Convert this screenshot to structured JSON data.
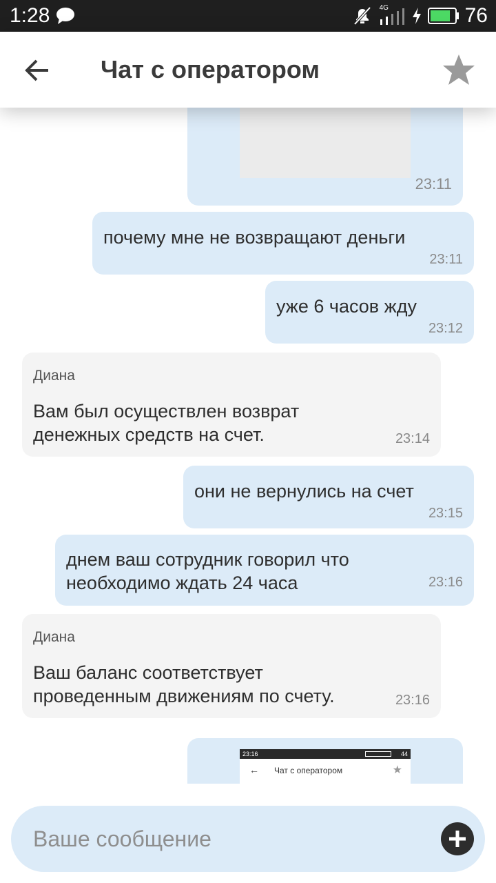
{
  "status_bar": {
    "time": "1:28",
    "network": "4G",
    "battery": "76"
  },
  "header": {
    "title": "Чат с оператором"
  },
  "messages": [
    {
      "type": "image",
      "time": "23:11"
    },
    {
      "type": "out",
      "text": "почему мне не возвращают деньги",
      "time": "23:11"
    },
    {
      "type": "out",
      "text": "уже 6 часов жду",
      "time": "23:12"
    },
    {
      "type": "in",
      "sender": "Диана",
      "line1": "Вам был осуществлен возврат",
      "line2": "денежных средств на счет.",
      "time": "23:14"
    },
    {
      "type": "out",
      "text": "они не вернулись на счет",
      "time": "23:15"
    },
    {
      "type": "out",
      "line1": "днем ваш сотрудник говорил что",
      "line2": "необходимо ждать 24 часа",
      "time": "23:16"
    },
    {
      "type": "in",
      "sender": "Диана",
      "line1": "Ваш баланс соответствует",
      "line2": "проведенным движениям по счету.",
      "time": "23:16"
    },
    {
      "type": "image"
    }
  ],
  "thumbnail": {
    "time": "23:16",
    "battery": "44",
    "title": "Чат с оператором"
  },
  "composer": {
    "placeholder": "Ваше сообщение"
  },
  "colors": {
    "outgoing_bubble": "#dcebf8",
    "incoming_bubble": "#f4f4f4",
    "battery_green": "#4cd964"
  }
}
